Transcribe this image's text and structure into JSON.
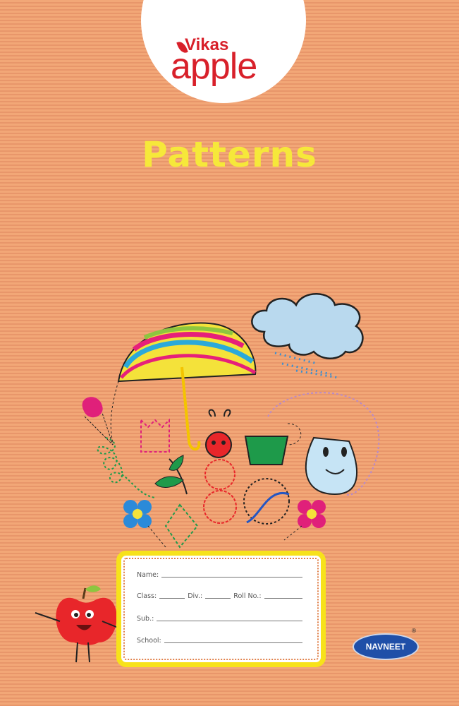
{
  "brand": {
    "top": "Vikas",
    "main": "apple",
    "publisher": "NAVNEET",
    "registered": "®"
  },
  "cover": {
    "title": "Patterns"
  },
  "form": {
    "name": "Name:",
    "class": "Class:",
    "div": "Div.:",
    "roll": "Roll No.:",
    "subject": "Sub.:",
    "school": "School:"
  },
  "colors": {
    "background": "#ef9f6e",
    "brand_red": "#d8202a",
    "title_yellow": "#f6e83a",
    "publisher_blue": "#1f4fa8"
  }
}
